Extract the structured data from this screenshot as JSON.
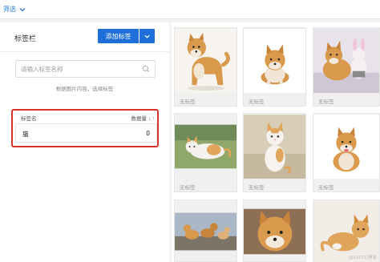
{
  "topbar": {
    "filter_label": "筛选"
  },
  "left_panel": {
    "title": "标签栏",
    "add_button_label": "添加标签",
    "search_placeholder": "请输入标签名称",
    "hint": "根据图片内容，选择标签",
    "table": {
      "col_name": "标签名",
      "col_count": "数据量",
      "sort_icon": "↓↑",
      "rows": [
        {
          "name": "猫",
          "count": "0"
        }
      ]
    }
  },
  "images": [
    {
      "label": "无标签",
      "subject": "shiba-standing-icon"
    },
    {
      "label": "无标签",
      "subject": "shiba-sitting-icon"
    },
    {
      "label": "无标签",
      "subject": "shiba-toy-icon"
    },
    {
      "label": "无标签",
      "subject": "cat-lying-icon"
    },
    {
      "label": "无标签",
      "subject": "cat-sitting-icon"
    },
    {
      "label": "无标签",
      "subject": "shiba-smiling-icon"
    },
    {
      "label": "",
      "subject": "dogs-rocks-icon"
    },
    {
      "label": "",
      "subject": "shiba-closeup-icon"
    },
    {
      "label": "",
      "subject": "cat-ginger-icon"
    }
  ],
  "colors": {
    "accent": "#1e6fd9",
    "highlight_border": "#d9342b",
    "link": "#2b7fd9",
    "shiba": "#d99a4e",
    "cat_orange": "#e0a45a"
  },
  "watermark": "@51CTO博客"
}
